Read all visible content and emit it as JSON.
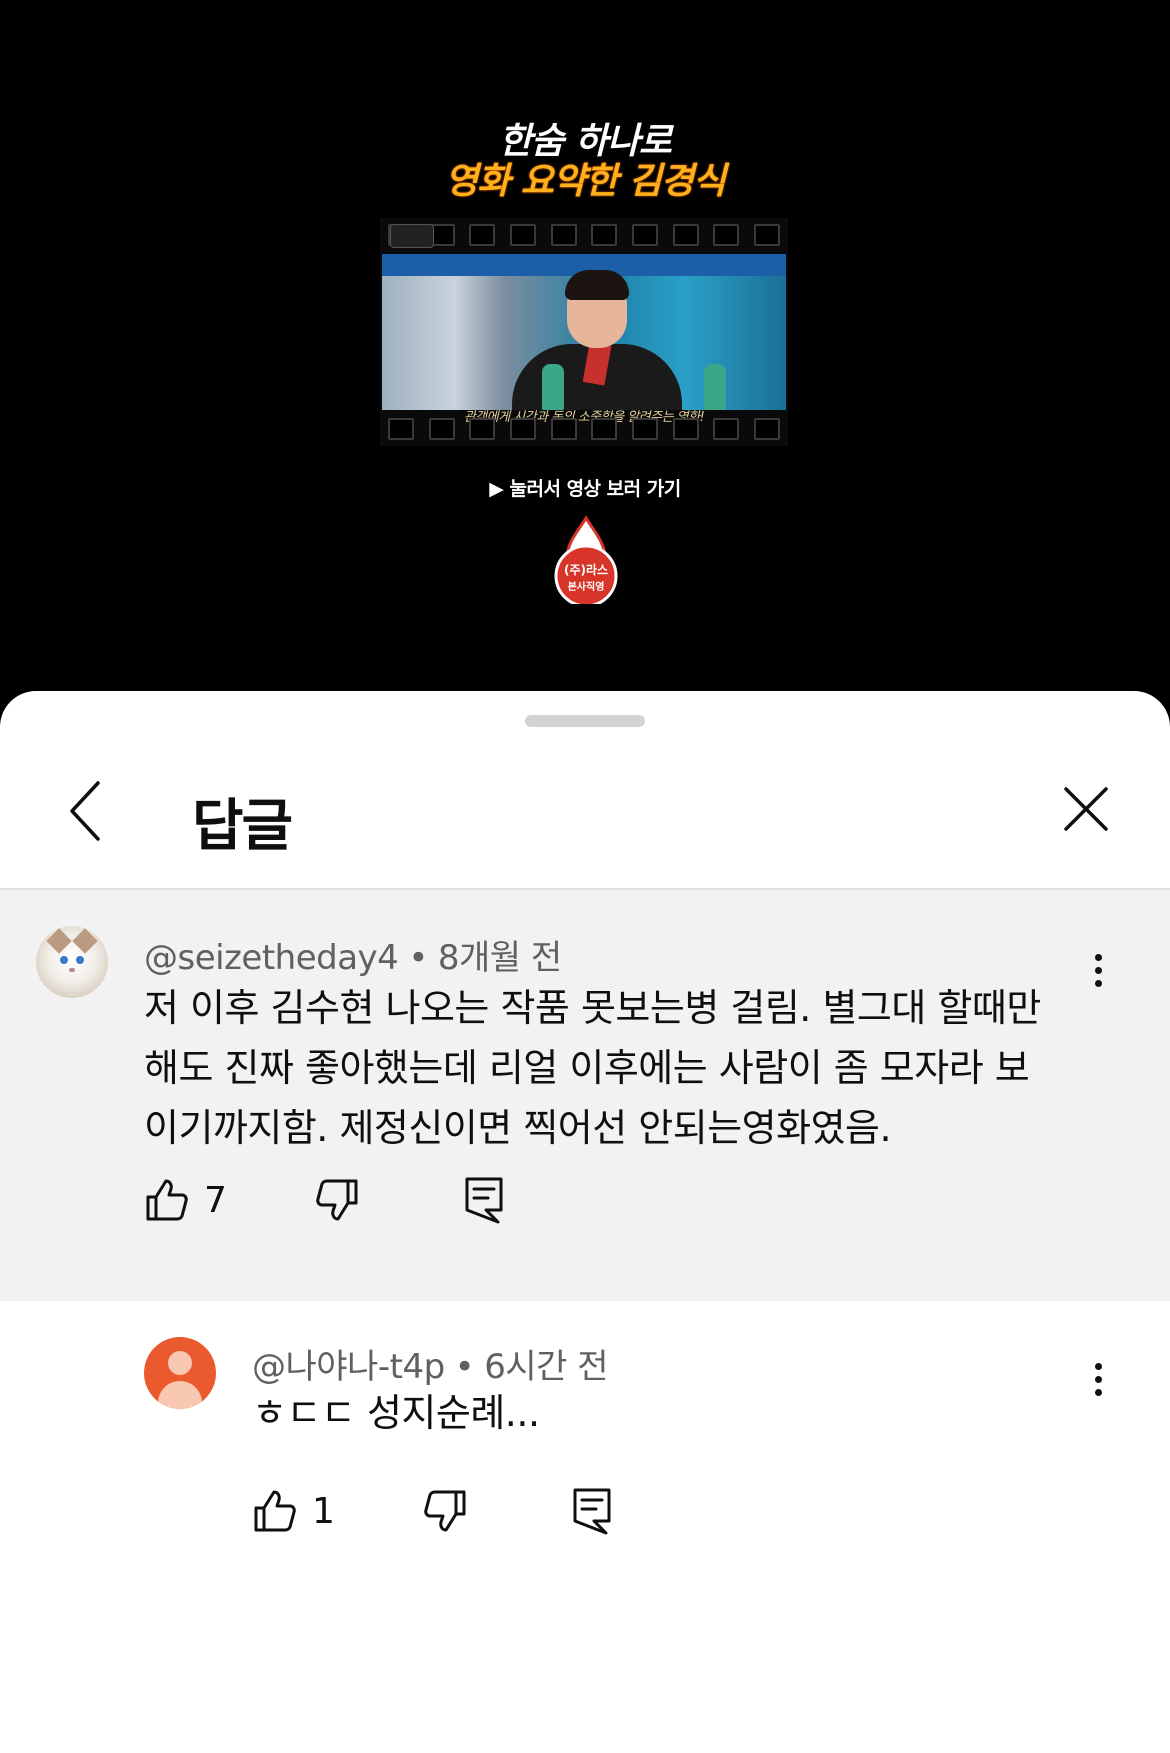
{
  "video": {
    "title_line1": "한숨 하나로",
    "title_line2": "영화 요약한 김경식",
    "subtitle": "관객에게 시간과 돈의 소중함을 알려주는 영화!",
    "play_hint": "▶ 눌러서 영상 보러 가기",
    "channel_logo_text": "(주)라스 본사직영",
    "colors": {
      "title_primary": "#ffffff",
      "title_accent": "#ffb01a",
      "logo_red": "#d8352a"
    }
  },
  "sheet": {
    "title": "답글",
    "back_icon": "chevron-left-icon",
    "close_icon": "close-icon"
  },
  "parent_comment": {
    "author": "@seizetheday4",
    "separator": "•",
    "time": "8개월 전",
    "text": "저 이후 김수현 나오는 작품 못보는병 걸림. 별그대 할때만 해도 진짜 좋아했는데 리얼 이후에는 사람이 좀 모자라 보이기까지함. 제정신이면 찍어선 안되는영화였음.",
    "lines": [
      "저 이후 김수현 나오는 작품 못보는병 걸림. 별그대 할때만",
      "해도 진짜 좋아했는데 리얼 이후에는 사람이 좀 모자라 보",
      "이기까지함. 제정신이면 찍어선 안되는영화였음."
    ],
    "likes": "7",
    "avatar": "cat-avatar"
  },
  "reply": {
    "author": "@나야나-t4p",
    "separator": "•",
    "time": "6시간 전",
    "text": "ㅎㄷㄷ 성지순례...",
    "likes": "1",
    "avatar": "default-person-avatar",
    "avatar_color": "#ea5a2e"
  }
}
